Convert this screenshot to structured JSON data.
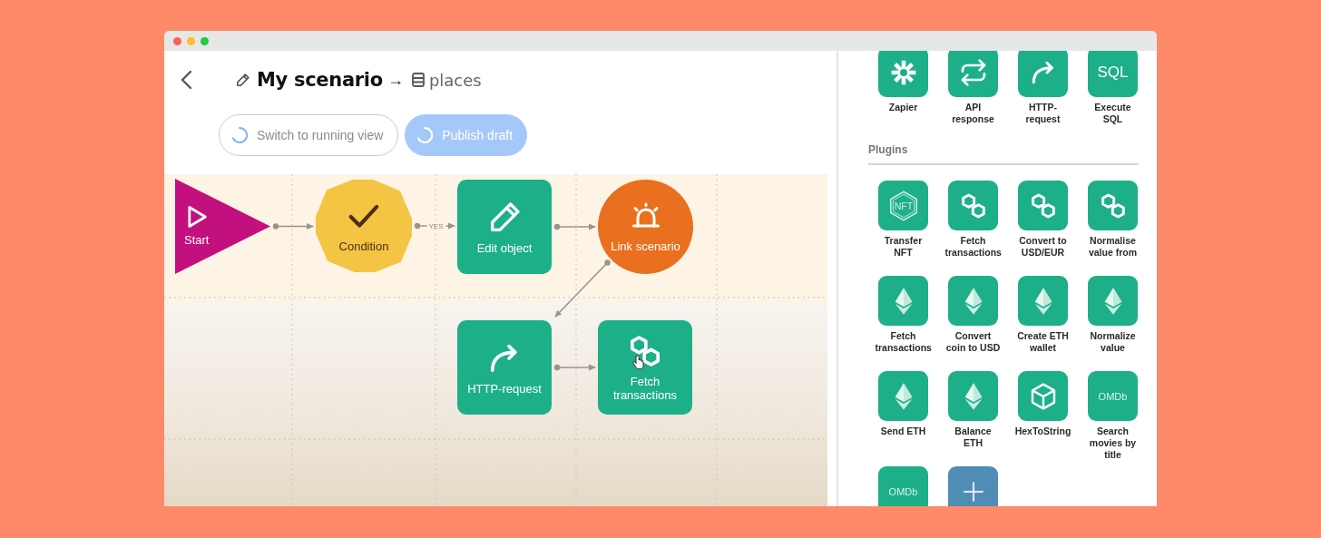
{
  "header": {
    "title": "My scenario",
    "arrow": "→",
    "target": "places"
  },
  "buttons": [
    {
      "label": "Switch to running view",
      "kind": "outline",
      "loading": true
    },
    {
      "label": "Publish draft",
      "kind": "primary",
      "loading": true
    }
  ],
  "flow": {
    "nodes": [
      {
        "kind": "start",
        "label": "Start"
      },
      {
        "kind": "condition",
        "label": "Condition"
      },
      {
        "kind": "edit",
        "label": "Edit object"
      },
      {
        "kind": "link",
        "label": "Link scenario"
      },
      {
        "kind": "request",
        "label": "HTTP-request"
      },
      {
        "kind": "chain",
        "label": "Fetch transactions"
      }
    ],
    "edges": [
      {
        "kind": "plain"
      },
      {
        "kind": "labeled",
        "label": "YES"
      },
      {
        "kind": "plain"
      },
      {
        "kind": "plain"
      },
      {
        "kind": "plain"
      }
    ]
  },
  "palette": {
    "top": [
      {
        "kind": "asterisk",
        "label": "Zapier"
      },
      {
        "kind": "swap",
        "label": "API response"
      },
      {
        "kind": "arrow",
        "label": "HTTP-request"
      },
      {
        "kind": "text",
        "glyph": "SQL",
        "label": "Execute SQL"
      }
    ],
    "section_title": "Plugins",
    "plugins": [
      {
        "kind": "nft",
        "glyph": "NFT",
        "label": "Transfer NFT"
      },
      {
        "kind": "chain",
        "label": "Fetch transactions"
      },
      {
        "kind": "chain",
        "label": "Convert to USD/EUR"
      },
      {
        "kind": "chain",
        "label": "Normalise value from"
      },
      {
        "kind": "eth",
        "label": "Fetch transactions"
      },
      {
        "kind": "eth",
        "label": "Convert coin to USD"
      },
      {
        "kind": "eth",
        "label": "Create ETH wallet"
      },
      {
        "kind": "eth",
        "label": "Normalize value"
      },
      {
        "kind": "eth",
        "label": "Send ETH"
      },
      {
        "kind": "eth",
        "label": "Balance ETH"
      },
      {
        "kind": "cube",
        "label": "HexToString"
      },
      {
        "kind": "text",
        "glyph": "OMDb",
        "label": "Search movies by title"
      },
      {
        "kind": "text",
        "glyph": "OMDb"
      },
      {
        "kind": "add"
      }
    ]
  }
}
